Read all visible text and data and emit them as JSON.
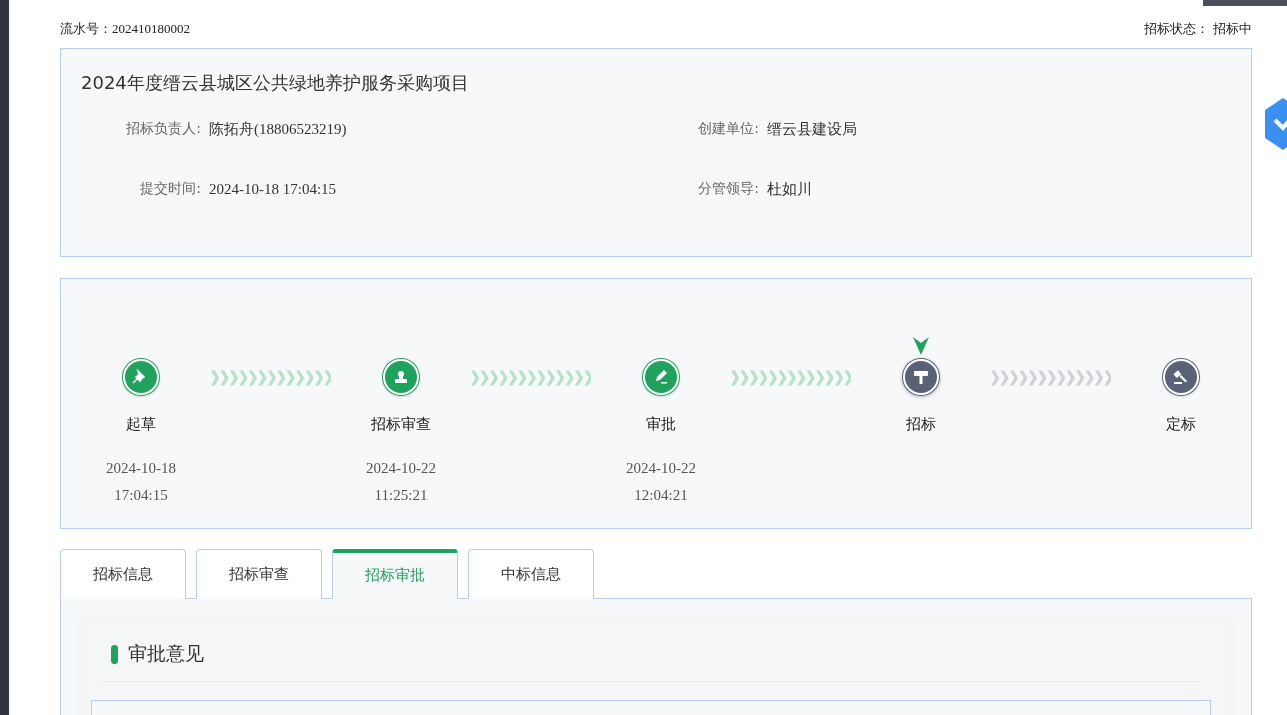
{
  "serial": {
    "label": "流水号：",
    "value": "202410180002"
  },
  "status": {
    "label": "招标状态：",
    "value": "招标中"
  },
  "project": {
    "title": "2024年度缙云县城区公共绿地养护服务采购项目",
    "fields": [
      {
        "label": "招标负责人:",
        "value": "陈拓舟(18806523219)"
      },
      {
        "label": "创建单位:",
        "value": "缙云县建设局"
      },
      {
        "label": "提交时间:",
        "value": "2024-10-18 17:04:15"
      },
      {
        "label": "分管领导:",
        "value": "杜如川"
      }
    ]
  },
  "steps": [
    {
      "kind": "pin",
      "label": "起草",
      "done": true,
      "current": false,
      "date": "2024-10-18",
      "time": "17:04:15"
    },
    {
      "kind": "stamp",
      "label": "招标审查",
      "done": true,
      "current": false,
      "date": "2024-10-22",
      "time": "11:25:21"
    },
    {
      "kind": "pen",
      "label": "审批",
      "done": true,
      "current": false,
      "date": "2024-10-22",
      "time": "12:04:21"
    },
    {
      "kind": "hammer",
      "label": "招标",
      "done": false,
      "current": true
    },
    {
      "kind": "gavel",
      "label": "定标",
      "done": false,
      "current": false
    }
  ],
  "tabs": [
    {
      "label": "招标信息",
      "selected": false
    },
    {
      "label": "招标审查",
      "selected": false
    },
    {
      "label": "招标审批",
      "selected": true
    },
    {
      "label": "中标信息",
      "selected": false
    }
  ],
  "section": {
    "title": "审批意见"
  }
}
